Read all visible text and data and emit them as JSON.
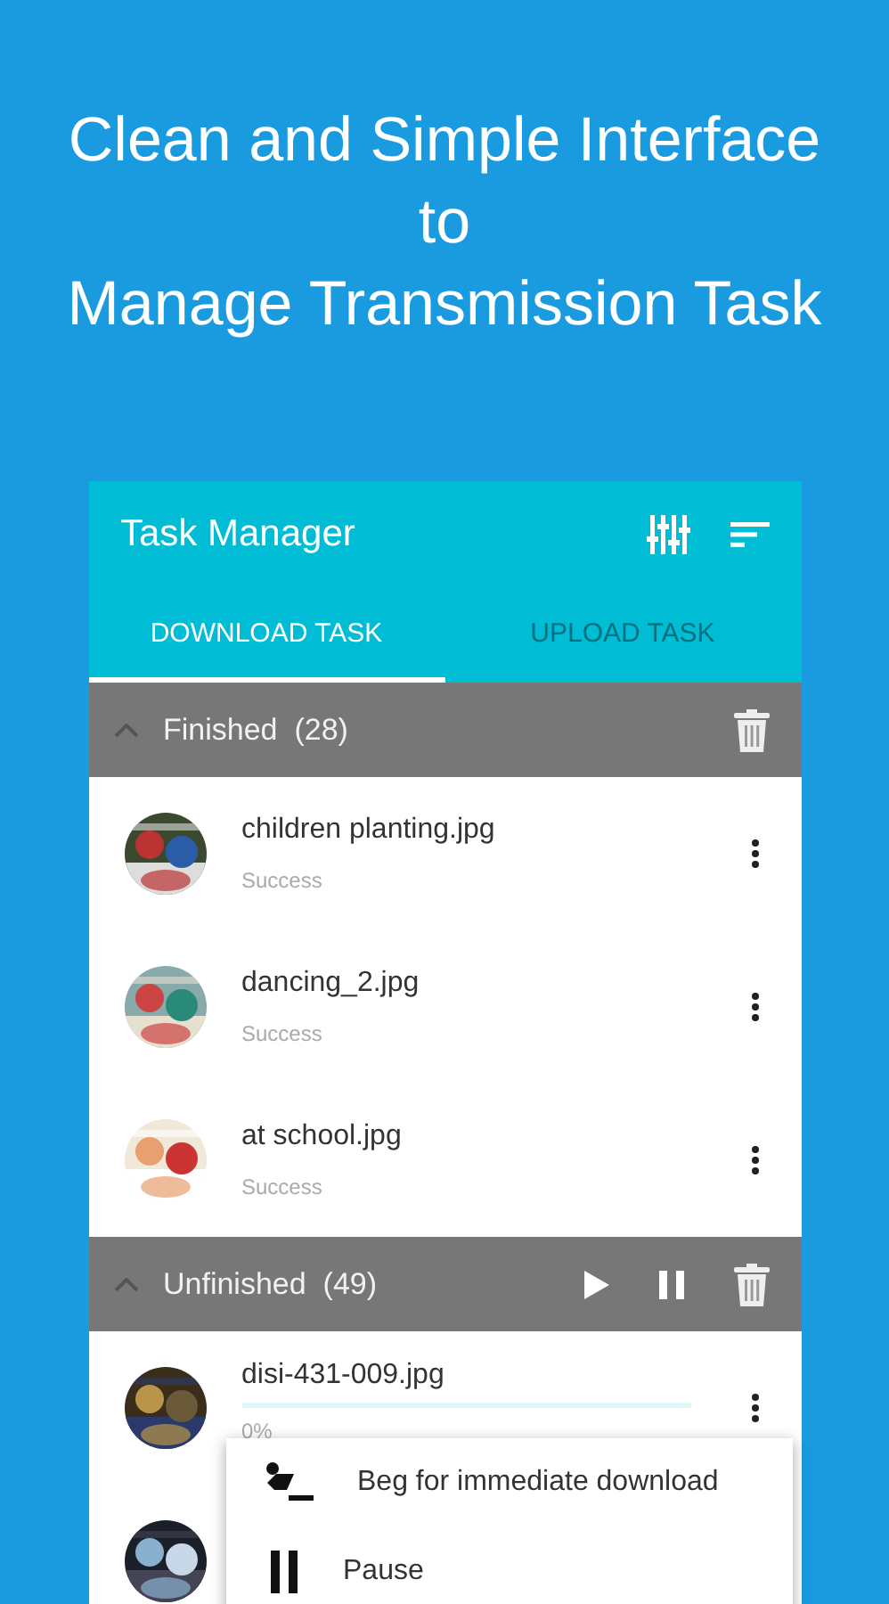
{
  "headline": [
    "Clean and Simple Interface",
    "to",
    "Manage Transmission Task"
  ],
  "app_bar": {
    "title": "Task Manager"
  },
  "tabs": [
    {
      "label": "DOWNLOAD TASK",
      "selected": true
    },
    {
      "label": "UPLOAD TASK",
      "selected": false
    }
  ],
  "sections": [
    {
      "kind": "finished",
      "title": "Finished",
      "count": "(28)",
      "expanded": true,
      "items": [
        {
          "kind": "finished",
          "name": "children planting.jpg",
          "status": "Success"
        },
        {
          "kind": "finished",
          "name": "dancing_2.jpg",
          "status": "Success"
        },
        {
          "kind": "finished",
          "name": "at school.jpg",
          "status": "Success"
        }
      ]
    },
    {
      "kind": "unfinished",
      "title": "Unfinished",
      "count": "(49)",
      "expanded": true,
      "items": [
        {
          "kind": "progress",
          "name": "disi-431-009.jpg",
          "level": 0,
          "reading": "0%"
        },
        {
          "kind": "avatar-only"
        }
      ]
    }
  ],
  "menu": [
    {
      "label": "Beg for immediate download"
    },
    {
      "label": "Pause"
    }
  ]
}
